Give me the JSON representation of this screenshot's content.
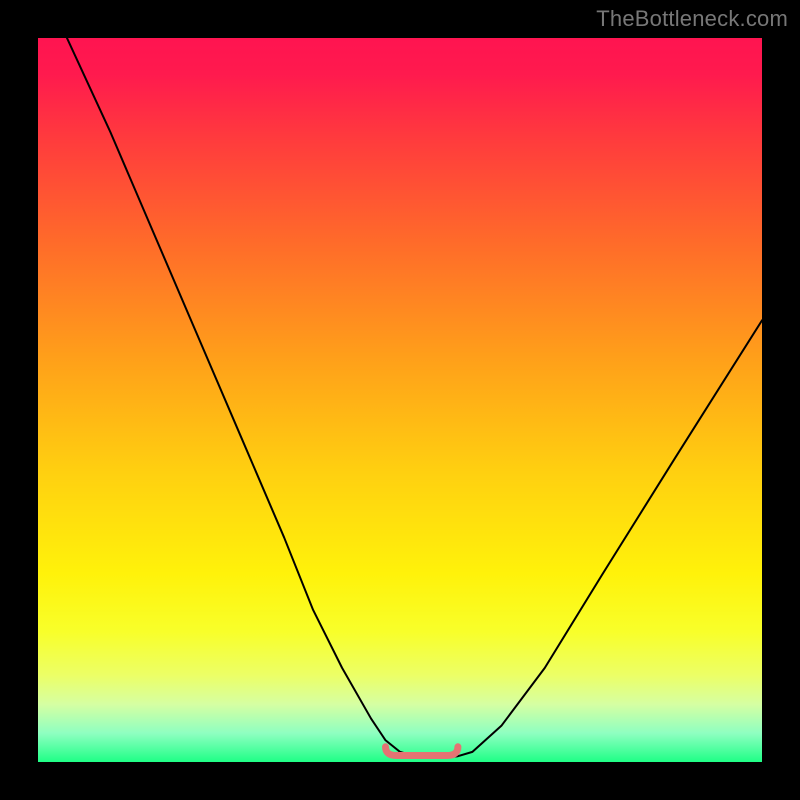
{
  "watermark": "TheBottleneck.com",
  "chart_data": {
    "type": "line",
    "title": "",
    "xlabel": "",
    "ylabel": "",
    "xlim": [
      0,
      100
    ],
    "ylim": [
      0,
      100
    ],
    "series": [
      {
        "name": "curve",
        "x": [
          4,
          10,
          16,
          22,
          28,
          34,
          38,
          42,
          46,
          48,
          50,
          52,
          54,
          56,
          58,
          60,
          64,
          70,
          78,
          88,
          100
        ],
        "y": [
          100,
          87,
          73,
          59,
          45,
          31,
          21,
          13,
          6,
          3,
          1.4,
          0.8,
          0.6,
          0.6,
          0.8,
          1.4,
          5,
          13,
          26,
          42,
          61
        ]
      }
    ],
    "valley_marker": {
      "x_start": 48,
      "x_end": 58,
      "y": 0.9,
      "color": "#e57373"
    },
    "background_gradient": {
      "top": "#ff1450",
      "bottom": "#1fff86"
    }
  }
}
